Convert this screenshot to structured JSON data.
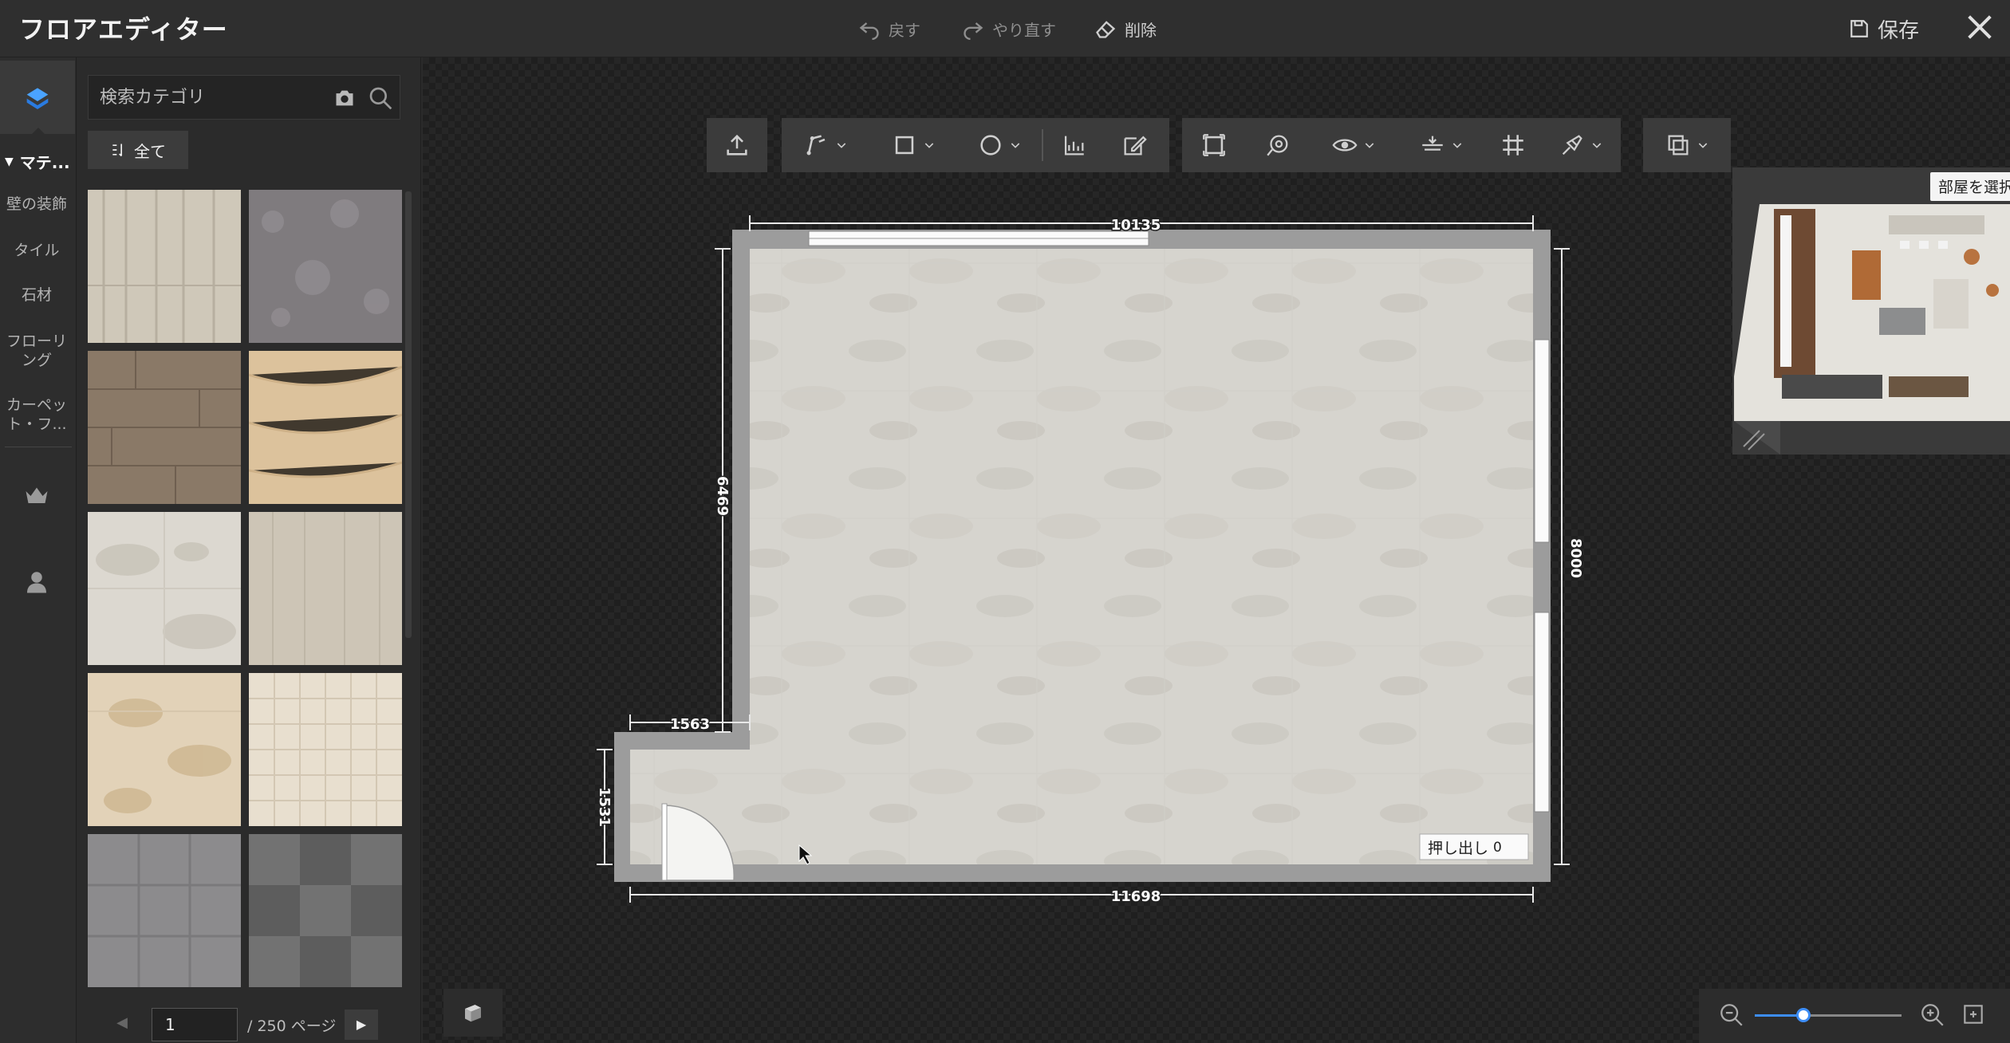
{
  "app": {
    "title": "フロアエディター"
  },
  "titlebar": {
    "undo_label": "戻す",
    "redo_label": "やり直す",
    "delete_label": "削除",
    "save_label": "保存",
    "undo_icon": "undo-arrow-icon",
    "redo_icon": "redo-arrow-icon",
    "delete_icon": "eraser-icon",
    "save_icon": "floppy-disk-icon",
    "close_icon": "close-icon"
  },
  "rail": {
    "category_header": "マテ...",
    "items": [
      {
        "label": "壁の装飾"
      },
      {
        "label": "タイル"
      },
      {
        "label": "石材"
      },
      {
        "label": "フローリ\nング"
      },
      {
        "label": "カーペッ\nト・フ..."
      }
    ],
    "icons": [
      "material-icon",
      "crown-icon",
      "user-icon"
    ]
  },
  "panel": {
    "search_placeholder": "検索カテゴリ",
    "filter_label": "全て",
    "tiles": [
      {
        "name": "birch-wood",
        "color": "#cfc8b9"
      },
      {
        "name": "grey-carpet",
        "color": "#7f7b7e"
      },
      {
        "name": "oak-plank-dark",
        "color": "#8a7967"
      },
      {
        "name": "light-oak",
        "color": "#dcc29c"
      },
      {
        "name": "marble-white",
        "color": "#dcd8d0"
      },
      {
        "name": "pale-wood",
        "color": "#cdc5b6"
      },
      {
        "name": "yellow-marble",
        "color": "#e2d2b8"
      },
      {
        "name": "beige-tile-grid",
        "color": "#e8dfcf"
      },
      {
        "name": "grey-stone-tile",
        "color": "#8c8b8d"
      },
      {
        "name": "dark-check-tile",
        "color": "#5d5d5d"
      }
    ],
    "pager": {
      "current": "1",
      "total_label": "/ 250 ページ"
    }
  },
  "toolbar": {
    "tools": [
      "upload-icon",
      "draw-wall-icon",
      "rectangle-icon",
      "circle-icon",
      "measure-icon",
      "edit-note-icon",
      "select-area-icon",
      "lasso-icon",
      "eye-icon",
      "align-icon",
      "grid-icon",
      "paint-icon",
      "layers-icon"
    ]
  },
  "plan": {
    "dim_top": "10135",
    "dim_right": "8000",
    "dim_left_upper": "6469",
    "dim_bottom": "11698",
    "dim_notch_width": "1563",
    "dim_notch_height": "1531",
    "extrude_label": "押し出し",
    "extrude_value": "0",
    "floor_color": "#d6d4ce",
    "wall_color": "#9c9c9c"
  },
  "minimap": {
    "tooltip": "部屋を選択"
  },
  "zoom": {
    "level": 0.33
  },
  "colors": {
    "accent": "#3d8df5"
  }
}
